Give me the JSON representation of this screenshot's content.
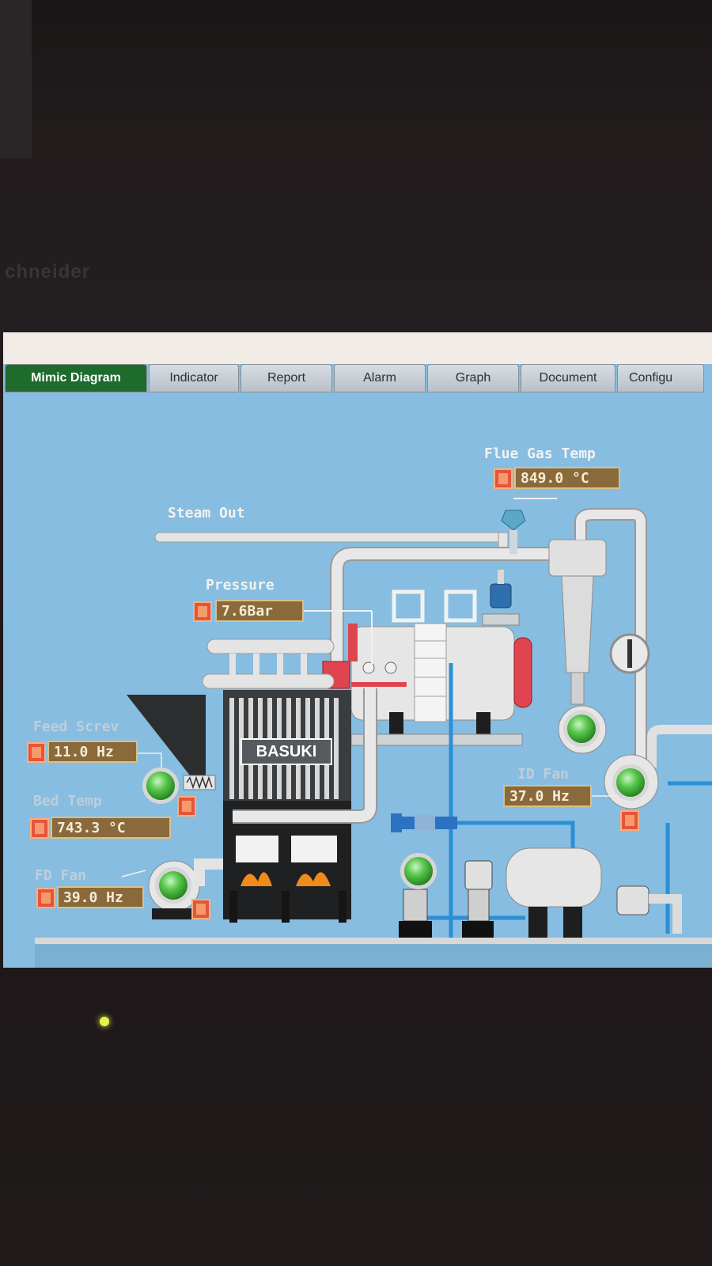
{
  "tabs": [
    {
      "label": "Mimic Diagram",
      "active": true
    },
    {
      "label": "Indicator",
      "active": false
    },
    {
      "label": "Report",
      "active": false
    },
    {
      "label": "Alarm",
      "active": false
    },
    {
      "label": "Graph",
      "active": false
    },
    {
      "label": "Document",
      "active": false
    },
    {
      "label": "Configu",
      "active": false
    }
  ],
  "diagram": {
    "flue_gas": {
      "label": "Flue Gas Temp",
      "value": "849.0 °C"
    },
    "steam_out": {
      "label": "Steam Out"
    },
    "pressure": {
      "label": "Pressure",
      "value": "7.6Bar"
    },
    "feed_screw": {
      "label": "Feed Screv",
      "value": "11.0 Hz"
    },
    "bed_temp": {
      "label": "Bed Temp",
      "value": "743.3  °C"
    },
    "fd_fan": {
      "label": "FD Fan",
      "value": "39.0 Hz"
    },
    "id_fan": {
      "label": "ID Fan",
      "value": "37.0 Hz"
    },
    "boiler_brand": "BASUKI"
  },
  "colors": {
    "panel_bg": "#87bde0",
    "active_tab": "#1f6b2e",
    "value_box": "#8a6a3a",
    "indicator": "#e5553c",
    "pump_green": "#57c64b",
    "water_pipe": "#2b8fd6"
  }
}
